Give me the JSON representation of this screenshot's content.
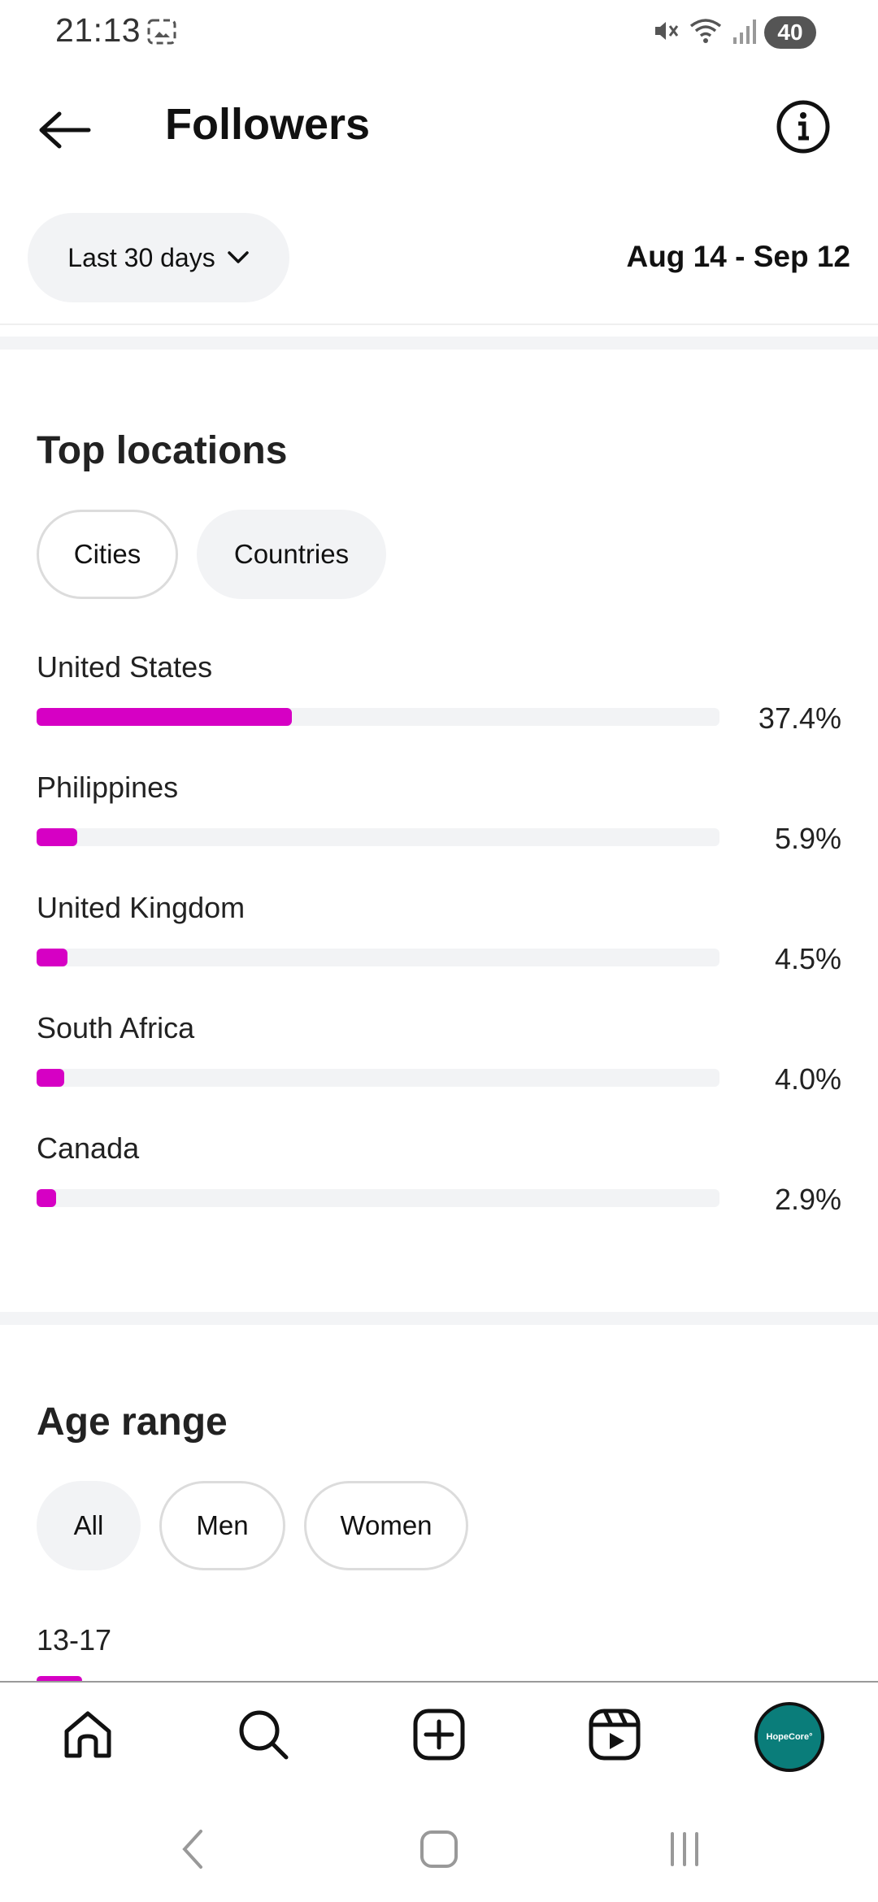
{
  "status_bar": {
    "time": "21:13",
    "battery": "40"
  },
  "header": {
    "title": "Followers"
  },
  "filter": {
    "range_label": "Last 30 days",
    "date_range": "Aug 14 - Sep 12"
  },
  "top_locations": {
    "title": "Top locations",
    "tabs": [
      {
        "label": "Cities",
        "selected": false
      },
      {
        "label": "Countries",
        "selected": true
      }
    ],
    "items": [
      {
        "label": "United States",
        "percent": "37.4%",
        "value": 37.4
      },
      {
        "label": "Philippines",
        "percent": "5.9%",
        "value": 5.9
      },
      {
        "label": "United Kingdom",
        "percent": "4.5%",
        "value": 4.5
      },
      {
        "label": "South Africa",
        "percent": "4.0%",
        "value": 4.0
      },
      {
        "label": "Canada",
        "percent": "2.9%",
        "value": 2.9
      }
    ]
  },
  "age_range": {
    "title": "Age range",
    "tabs": [
      {
        "label": "All",
        "selected": true
      },
      {
        "label": "Men",
        "selected": false
      },
      {
        "label": "Women",
        "selected": false
      }
    ],
    "first_item_label": "13-17"
  },
  "bottom_nav": {
    "avatar_text": "HopeCore°",
    "items": [
      "home-icon",
      "search-icon",
      "create-icon",
      "reels-icon",
      "profile-avatar"
    ]
  },
  "colors": {
    "accent_bar": "#d600c4",
    "track": "#f2f3f5",
    "avatar_bg": "#0a7d7a"
  }
}
